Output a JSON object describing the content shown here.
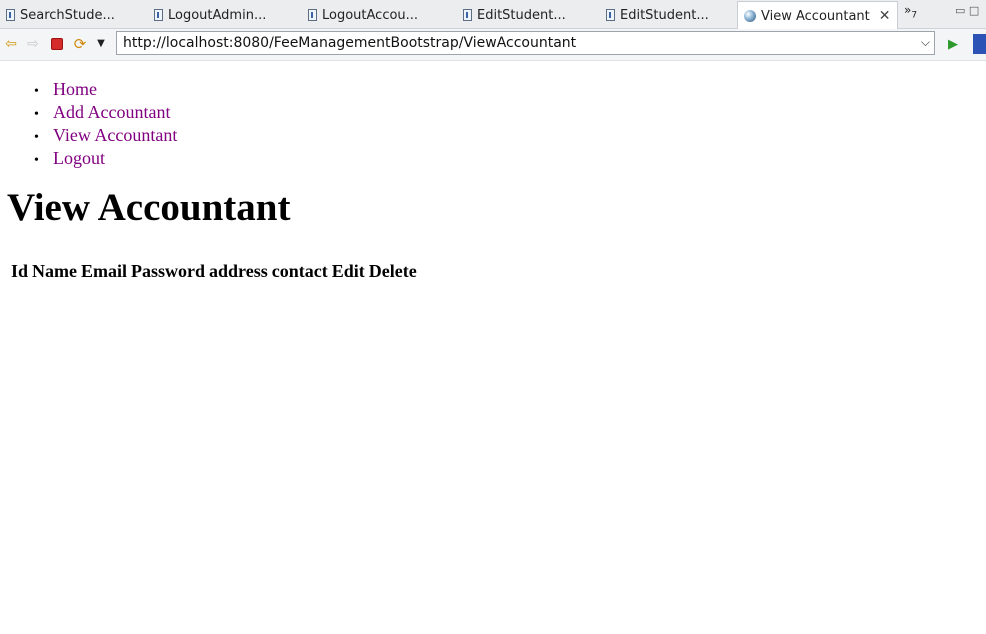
{
  "tabs": [
    {
      "label": "SearchStude..."
    },
    {
      "label": "LogoutAdmin..."
    },
    {
      "label": "LogoutAccou..."
    },
    {
      "label": "EditStudent..."
    },
    {
      "label": "EditStudent..."
    },
    {
      "label": "View Accountant",
      "active": true
    }
  ],
  "tab_overflow": {
    "label": "»",
    "count": "7"
  },
  "browser": {
    "url": "http://localhost:8080/FeeManagementBootstrap/ViewAccountant"
  },
  "nav_menu": [
    {
      "label": "Home"
    },
    {
      "label": "Add Accountant"
    },
    {
      "label": "View Accountant"
    },
    {
      "label": "Logout"
    }
  ],
  "page": {
    "title": "View Accountant"
  },
  "table": {
    "headers": [
      "Id",
      "Name",
      "Email",
      "Password",
      "address",
      "contact",
      "Edit",
      "Delete"
    ]
  },
  "colors": {
    "link": "#800080",
    "stop": "#d62b2b",
    "go": "#2e9a2e"
  },
  "icons": [
    "back-arrow-icon",
    "forward-arrow-icon",
    "stop-icon",
    "refresh-icon",
    "dropdown-icon",
    "globe-icon",
    "close-icon",
    "go-icon"
  ]
}
